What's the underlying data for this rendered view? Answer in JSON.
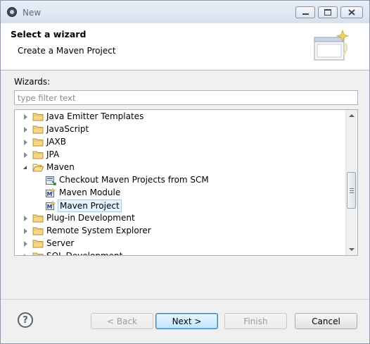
{
  "window": {
    "title": "New"
  },
  "banner": {
    "title": "Select a wizard",
    "description": "Create a Maven Project"
  },
  "wizards": {
    "label": "Wizards:",
    "filter_placeholder": "type filter text",
    "filter_value": ""
  },
  "tree": {
    "items": [
      {
        "label": "Java Emitter Templates",
        "kind": "folder",
        "state": "collapsed",
        "icon": "folder-icon"
      },
      {
        "label": "JavaScript",
        "kind": "folder",
        "state": "collapsed",
        "icon": "folder-icon"
      },
      {
        "label": "JAXB",
        "kind": "folder",
        "state": "collapsed",
        "icon": "folder-icon"
      },
      {
        "label": "JPA",
        "kind": "folder",
        "state": "collapsed",
        "icon": "folder-icon"
      },
      {
        "label": "Maven",
        "kind": "folder",
        "state": "expanded",
        "icon": "folder-open-icon"
      },
      {
        "label": "Checkout Maven Projects from SCM",
        "kind": "wizard",
        "icon": "maven-checkout-icon"
      },
      {
        "label": "Maven Module",
        "kind": "wizard",
        "icon": "maven-module-icon"
      },
      {
        "label": "Maven Project",
        "kind": "wizard",
        "icon": "maven-project-icon",
        "selected": true
      },
      {
        "label": "Plug-in Development",
        "kind": "folder",
        "state": "collapsed",
        "icon": "folder-icon"
      },
      {
        "label": "Remote System Explorer",
        "kind": "folder",
        "state": "collapsed",
        "icon": "folder-icon"
      },
      {
        "label": "Server",
        "kind": "folder",
        "state": "collapsed",
        "icon": "folder-icon"
      },
      {
        "label": "SQL Development",
        "kind": "folder",
        "state": "collapsed",
        "icon": "folder-icon"
      }
    ]
  },
  "buttons": {
    "back": "< Back",
    "next": "Next >",
    "finish": "Finish",
    "cancel": "Cancel"
  },
  "colors": {
    "selection_bg": "#e5f1fb",
    "selection_border": "#a6cae8",
    "folder_fill": "#f7d688",
    "default_button_border": "#3c7fb1"
  }
}
